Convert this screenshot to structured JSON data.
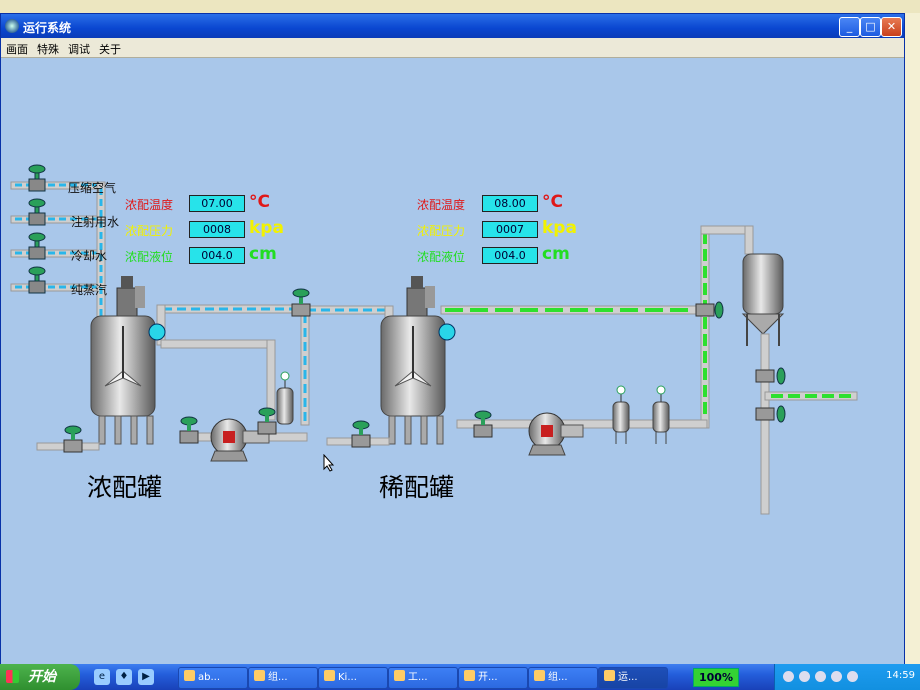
{
  "window": {
    "title": "运行系统",
    "min": "_",
    "max": "□",
    "close": "✕"
  },
  "menu": [
    "画面",
    "特殊",
    "调试",
    "关于"
  ],
  "inlets": [
    "压缩空气",
    "注射用水",
    "冷却水",
    "纯蒸汽"
  ],
  "tanks": [
    {
      "name": "浓配罐",
      "readings": [
        {
          "label": "浓配温度",
          "value": "07.00",
          "unit": "°C"
        },
        {
          "label": "浓配压力",
          "value": "0008",
          "unit": "kpa"
        },
        {
          "label": "浓配液位",
          "value": "004.0",
          "unit": "cm"
        }
      ]
    },
    {
      "name": "稀配罐",
      "readings": [
        {
          "label": "浓配温度",
          "value": "08.00",
          "unit": "°C"
        },
        {
          "label": "浓配压力",
          "value": "0007",
          "unit": "kpa"
        },
        {
          "label": "浓配液位",
          "value": "004.0",
          "unit": "cm"
        }
      ]
    }
  ],
  "colors": {
    "pipe": "#c8c8c8",
    "flow_blue": "#29b6ea",
    "flow_green": "#2ee02e",
    "valve": "#2aa05a",
    "temp_label": "#e01818",
    "pressure_label": "#f2f200",
    "level_label": "#22dd22",
    "readout_bg": "#27e3ea"
  },
  "taskbar": {
    "start_label": "开始",
    "tasks": [
      "ab...",
      "组...",
      "Ki...",
      "工...",
      "开...",
      "组...",
      "运..."
    ],
    "zoom": "100%",
    "clock": "14:59"
  }
}
